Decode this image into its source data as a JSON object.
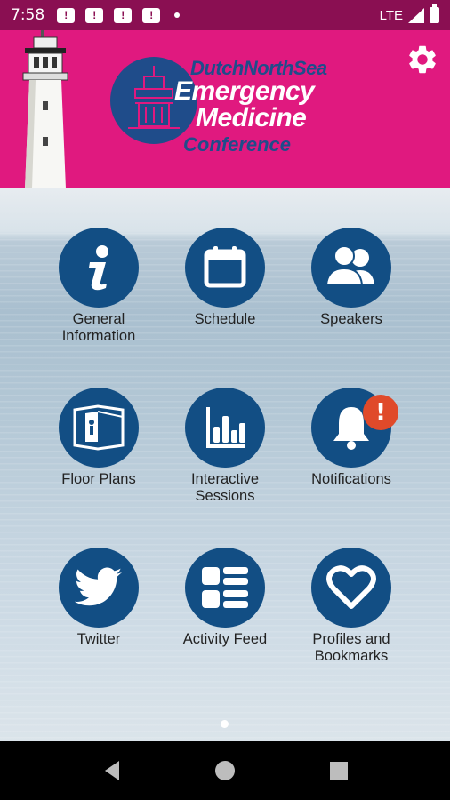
{
  "status_bar": {
    "time": "7:58",
    "notification_icons": [
      "message-alert-icon",
      "message-alert-icon",
      "message-alert-icon",
      "message-alert-icon"
    ],
    "network": "LTE"
  },
  "header": {
    "logo_lines": [
      "DutchNorthSea",
      "Emergency",
      "Medicine",
      "Conference"
    ],
    "background_color": "#e0197f",
    "accent_color": "#1f4c8a"
  },
  "grid": {
    "tile_color": "#124e84",
    "tiles": [
      {
        "label": "General\nInformation",
        "icon": "info-icon"
      },
      {
        "label": "Schedule",
        "icon": "calendar-icon"
      },
      {
        "label": "Speakers",
        "icon": "people-icon"
      },
      {
        "label": "Floor Plans",
        "icon": "floor-plan-icon"
      },
      {
        "label": "Interactive\nSessions",
        "icon": "bar-chart-icon"
      },
      {
        "label": "Notifications",
        "icon": "bell-icon",
        "badge": "!"
      },
      {
        "label": "Twitter",
        "icon": "twitter-icon"
      },
      {
        "label": "Activity Feed",
        "icon": "list-icon"
      },
      {
        "label": "Profiles and\nBookmarks",
        "icon": "heart-icon"
      }
    ]
  },
  "pager": {
    "current_page": 1,
    "total_pages": 1
  }
}
